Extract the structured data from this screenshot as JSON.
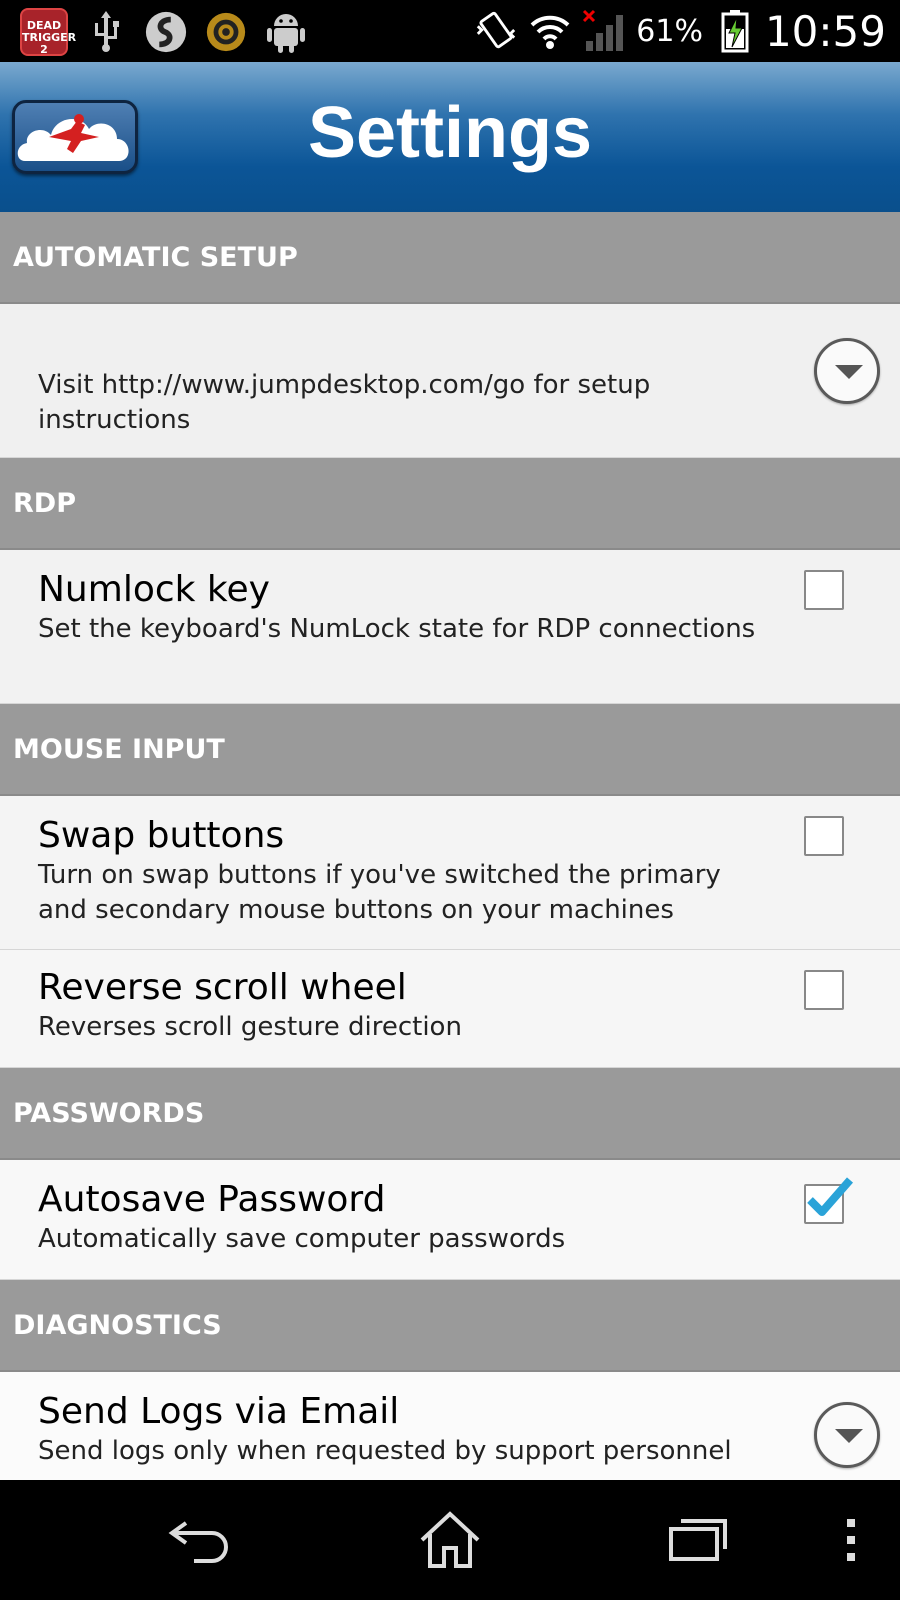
{
  "status_bar": {
    "notification_icons": [
      "dead-trigger-2-icon",
      "usb-icon",
      "shazam-icon",
      "target-app-icon",
      "android-icon"
    ],
    "dead_trigger_label": "DEAD TRIGGER 2",
    "system_icons": [
      "vibrate-icon",
      "wifi-icon",
      "signal-no-service-icon"
    ],
    "battery_percent": "61%",
    "time": "10:59"
  },
  "title_bar": {
    "title": "Settings",
    "logo": "jump-desktop-logo-icon"
  },
  "sections": [
    {
      "header": "AUTOMATIC SETUP",
      "items": [
        {
          "title": "",
          "summary": "Visit http://www.jumpdesktop.com/go for setup instructions",
          "control": "dropdown"
        }
      ]
    },
    {
      "header": "RDP",
      "items": [
        {
          "title": "Numlock key",
          "summary": "Set the keyboard's NumLock state for RDP connections",
          "control": "checkbox",
          "checked": false
        }
      ]
    },
    {
      "header": "MOUSE INPUT",
      "items": [
        {
          "title": "Swap buttons",
          "summary": "Turn on swap buttons if you've switched the primary and secondary mouse buttons on your machines",
          "control": "checkbox",
          "checked": false
        },
        {
          "title": "Reverse scroll wheel",
          "summary": "Reverses scroll gesture direction",
          "control": "checkbox",
          "checked": false
        }
      ]
    },
    {
      "header": "PASSWORDS",
      "items": [
        {
          "title": "Autosave Password",
          "summary": "Automatically save computer passwords",
          "control": "checkbox",
          "checked": true
        }
      ]
    },
    {
      "header": "DIAGNOSTICS",
      "items": [
        {
          "title": "Send Logs via Email",
          "summary": "Send logs only when requested by support personnel",
          "control": "dropdown"
        }
      ]
    }
  ],
  "nav_bar": {
    "buttons": [
      "back-icon",
      "home-icon",
      "recent-apps-icon",
      "overflow-menu-icon"
    ]
  },
  "colors": {
    "section_header_bg": "#9a9a9a",
    "title_bar_blue": "#0b5597",
    "checkbox_check": "#2aa3d8"
  }
}
